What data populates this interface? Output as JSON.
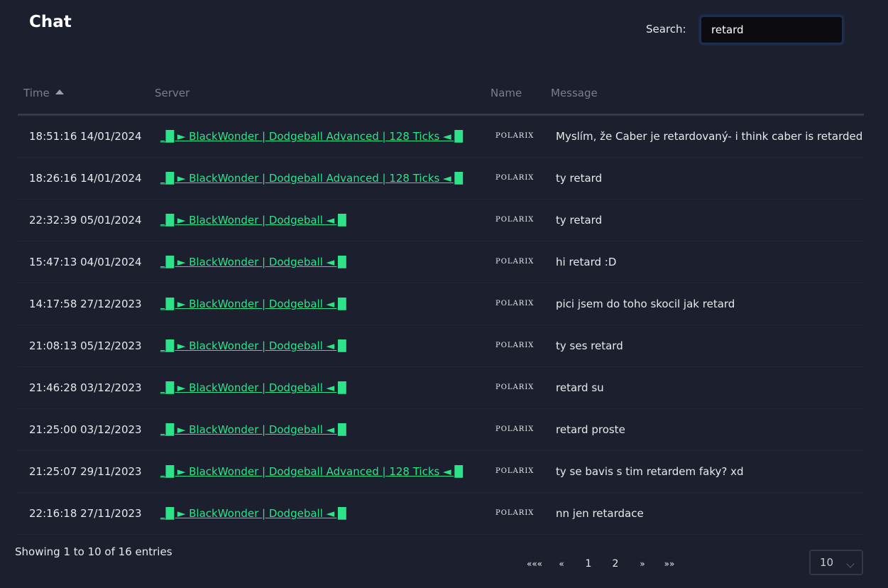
{
  "page": {
    "title": "Chat"
  },
  "search": {
    "label": "Search:",
    "value": "retard"
  },
  "table": {
    "columns": [
      "Time",
      "Server",
      "Name",
      "Message"
    ],
    "rows": [
      {
        "time": "18:51:16 14/01/2024",
        "server": "_█ ► BlackWonder | Dodgeball Advanced | 128 Ticks ◄ █",
        "name": "POLARIX",
        "message": "Myslím, že Caber je retardovaný- i think caber is retarded"
      },
      {
        "time": "18:26:16 14/01/2024",
        "server": "_█ ► BlackWonder | Dodgeball Advanced | 128 Ticks ◄ █",
        "name": "POLARIX",
        "message": "ty retard"
      },
      {
        "time": "22:32:39 05/01/2024",
        "server": "_█ ► BlackWonder | Dodgeball ◄ █",
        "name": "POLARIX",
        "message": "ty retard"
      },
      {
        "time": "15:47:13 04/01/2024",
        "server": "_█ ► BlackWonder | Dodgeball ◄ █",
        "name": "POLARIX",
        "message": "hi retard :D"
      },
      {
        "time": "14:17:58 27/12/2023",
        "server": "_█ ► BlackWonder | Dodgeball ◄ █",
        "name": "POLARIX",
        "message": "pici jsem do toho skocil jak retard"
      },
      {
        "time": "21:08:13 05/12/2023",
        "server": "_█ ► BlackWonder | Dodgeball ◄ █",
        "name": "POLARIX",
        "message": "ty ses retard"
      },
      {
        "time": "21:46:28 03/12/2023",
        "server": "_█ ► BlackWonder | Dodgeball ◄ █",
        "name": "POLARIX",
        "message": "retard su"
      },
      {
        "time": "21:25:00 03/12/2023",
        "server": "_█ ► BlackWonder | Dodgeball ◄ █",
        "name": "POLARIX",
        "message": "retard proste"
      },
      {
        "time": "21:25:07 29/11/2023",
        "server": "_█ ► BlackWonder | Dodgeball Advanced | 128 Ticks ◄ █",
        "name": "POLARIX",
        "message": "ty se bavis s tim retardem faky? xd"
      },
      {
        "time": "22:16:18 27/11/2023",
        "server": "_█ ► BlackWonder | Dodgeball ◄ █",
        "name": "POLARIX",
        "message": "nn jen retardace"
      }
    ]
  },
  "footer": {
    "info": "Showing 1 to 10 of 16 entries",
    "pagination": {
      "first": "«««",
      "prev": "«",
      "pages": [
        "1",
        "2"
      ],
      "next": "»",
      "last": "»»"
    },
    "page_length": "10"
  },
  "colors": {
    "background": "#1c1f2e",
    "server_link": "#2ee28a"
  }
}
